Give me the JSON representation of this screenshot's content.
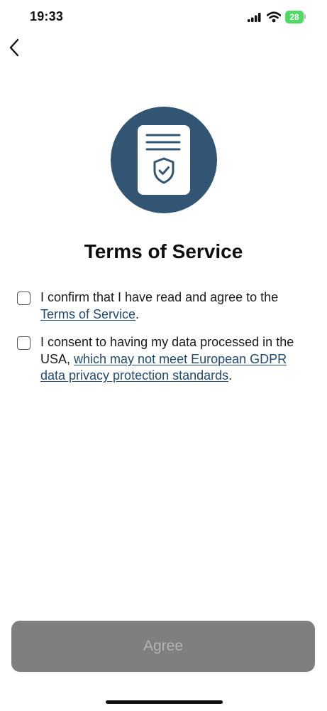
{
  "status_bar": {
    "time": "19:33",
    "battery": "28",
    "icons": [
      "signal-icon",
      "wifi-icon",
      "battery-icon"
    ]
  },
  "nav": {
    "back_icon": "chevron-left-icon"
  },
  "hero": {
    "icon": "document-shield-icon",
    "accent_color": "#335574"
  },
  "title": "Terms of Service",
  "consents": [
    {
      "checked": false,
      "text_before": "I confirm that I have read and agree to the ",
      "link_text": "Terms of Service",
      "text_after": "."
    },
    {
      "checked": false,
      "text_before": "I consent to having my data processed in the USA, ",
      "link_text": "which may not meet European GDPR data privacy protection standards",
      "text_after": "."
    }
  ],
  "agree_button": {
    "label": "Agree",
    "enabled": false
  }
}
